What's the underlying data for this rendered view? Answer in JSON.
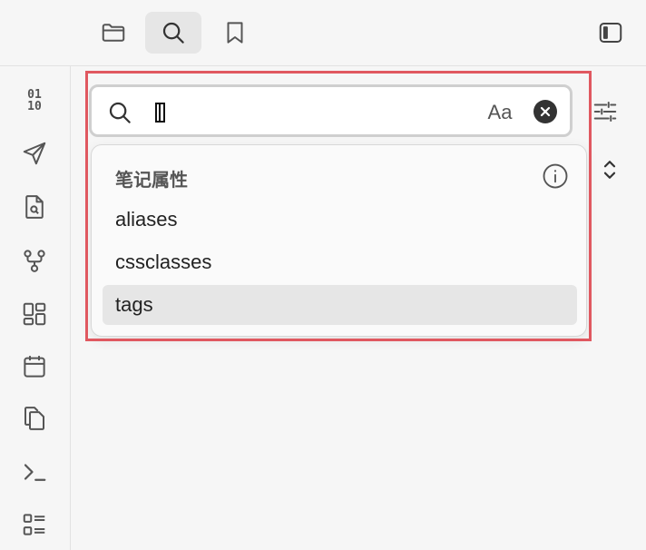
{
  "topbar": {
    "buttons": [
      {
        "icon": "folder-icon",
        "active": false
      },
      {
        "icon": "search-icon",
        "active": true
      },
      {
        "icon": "bookmark-icon",
        "active": false
      }
    ],
    "right_icon": "sidebar-toggle-icon"
  },
  "ribbon": {
    "binary_text": [
      "01",
      "10"
    ],
    "icons": [
      "binary-icon",
      "send-icon",
      "file-search-icon",
      "graph-icon",
      "layout-grid-icon",
      "calendar-icon",
      "copy-icon",
      "terminal-icon",
      "list-icon"
    ]
  },
  "search": {
    "value": "",
    "match_case_label": "Aa",
    "clear_icon": "clear-icon"
  },
  "dropdown": {
    "header": "笔记属性",
    "info_icon": "info-icon",
    "items": [
      {
        "label": "aliases",
        "selected": false
      },
      {
        "label": "cssclasses",
        "selected": false
      },
      {
        "label": "tags",
        "selected": true
      }
    ]
  },
  "pane": {
    "icons": [
      "sliders-icon",
      "chevron-up-down-icon"
    ]
  },
  "colors": {
    "background": "#f6f6f6",
    "highlight": "#e05860",
    "selected_row": "#e6e6e6"
  }
}
